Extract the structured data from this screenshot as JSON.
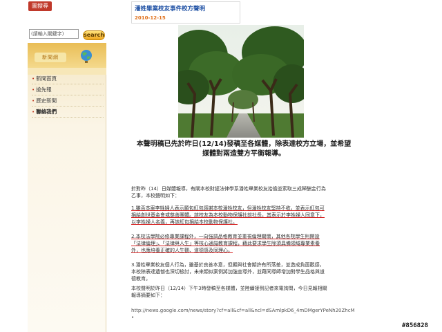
{
  "sidebar": {
    "logo_text": "圖搜尋",
    "search_placeholder": "(請輸入關鍵字)",
    "search_button": "search",
    "panel_tab": "新聞網",
    "menu": [
      {
        "label": "新聞首頁"
      },
      {
        "label": "搶先報"
      },
      {
        "label": "歷史新聞"
      },
      {
        "label": "聯絡我們"
      }
    ]
  },
  "article": {
    "title": "潘姓畢業校友事件校方聲明",
    "date": "2010-12-15",
    "headline": "本聲明稿已先於昨日(12/14)發稿至各媒體，除表達校方立場，並希望媒體對兩造雙方平衡報導。",
    "p1": [
      "針對昨（14）日媒體報導，有關本校財經法律學系潘姓畢業校友抬擔並索取三成歸酬金行為",
      "乙事，本校聲明如下："
    ],
    "p2": [
      "1.雖否本案李姓婦人表示願包紅包感謝本校潘姓校友，但潘姓校友堅持不收，並表示紅包可",
      "捐給創世基金會或慈善團體。該校友為本校動物保護社前社長，其表示於李姓婦人同意下，",
      "以李姓婦人名義，再該紅包捐給本校動物保護社。"
    ],
    "p3": [
      "2.本校法學院必修專業課程外，一向強調品格教育並重視倫理關懷，其他各院學生則開設",
      "「法律倫理」、「法律與人生」等核心通識教育課程，藉此要求學生除須具備領域專業素養",
      "外，也應培養正確的人生觀、道德感及同理心。"
    ],
    "p4": [
      "3.潘姓畢業校友個人行為，雖基於良善本意，但顯與社會期許有所落差，並造成負面觀感，",
      "本校除表達遺憾也深切檢討，未來類似案例將加強宣導外，並藉同導師增加對學生品格與道",
      "德教育。"
    ],
    "p5": [
      "本校聲明於昨日（12/14）下午3時發稿至各媒體，並陸續接到記者來電詢問，今日見報相關",
      "報導摘要如下："
    ],
    "url": "http://news.google.com/news/story?cf=all&cf=all&ncl=dSAmlpkD6_4mDMgerYPeNh20ZhcM •"
  },
  "watermark": "#856828"
}
